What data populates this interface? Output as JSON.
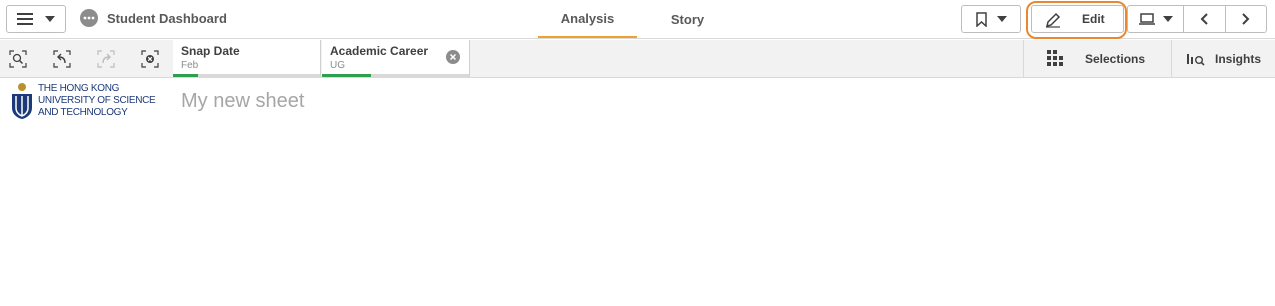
{
  "header": {
    "app_title": "Student Dashboard",
    "tabs": [
      {
        "label": "Analysis",
        "active": true
      },
      {
        "label": "Story",
        "active": false
      }
    ],
    "edit_label": "Edit",
    "icons": [
      "hamburger-menu-icon",
      "app-more-icon",
      "bookmark-icon",
      "pencil-icon",
      "presentation-icon",
      "chevron-left-icon",
      "chevron-right-icon"
    ]
  },
  "selection_bar": {
    "tools": [
      "smart-search-icon",
      "step-back-icon",
      "step-forward-icon",
      "clear-all-icon"
    ],
    "chips": [
      {
        "field": "Snap Date",
        "value": "Feb",
        "selected_fraction": 0.17
      },
      {
        "field": "Academic Career",
        "value": "UG",
        "selected_fraction": 0.33
      }
    ],
    "selections_label": "Selections",
    "insights_label": "Insights"
  },
  "sheet": {
    "logo_lines": [
      "THE HONG KONG",
      "UNIVERSITY OF SCIENCE",
      "AND TECHNOLOGY"
    ],
    "title": "My new sheet"
  },
  "colors": {
    "accent_tab": "#f0a030",
    "highlight": "#e8892f",
    "selection_green": "#2e9e4f",
    "logo_blue": "#1c3a7a",
    "logo_gold": "#b8932c"
  }
}
